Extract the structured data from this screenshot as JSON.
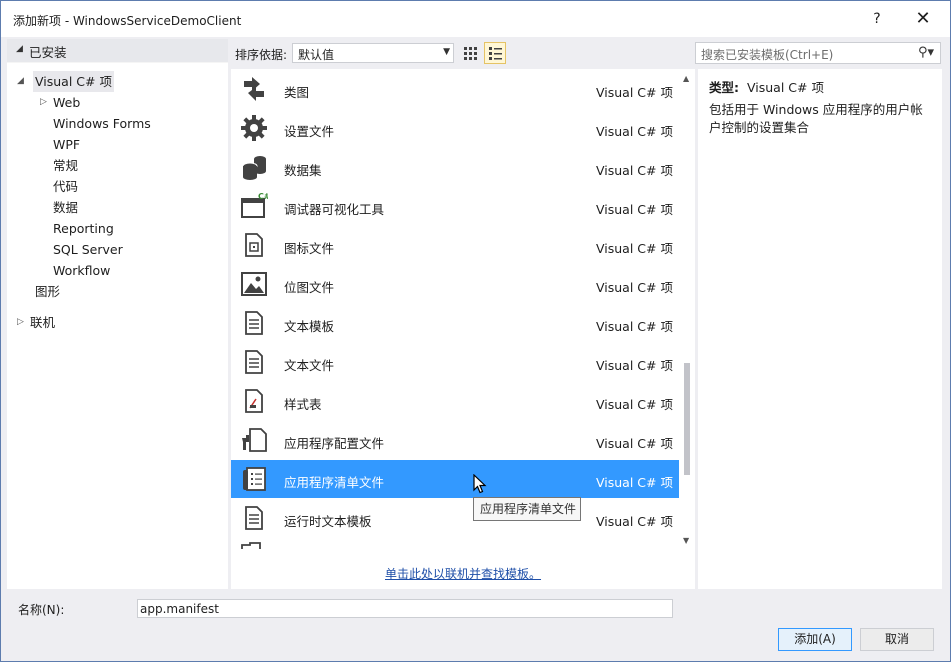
{
  "window": {
    "title": "添加新项 - WindowsServiceDemoClient",
    "help": "?",
    "close": "✕"
  },
  "tree": {
    "installed_label": "已安装",
    "items": [
      {
        "label": "Visual C# 项"
      },
      {
        "label": "Web"
      },
      {
        "label": "Windows Forms"
      },
      {
        "label": "WPF"
      },
      {
        "label": "常规"
      },
      {
        "label": "代码"
      },
      {
        "label": "数据"
      },
      {
        "label": "Reporting"
      },
      {
        "label": "SQL Server"
      },
      {
        "label": "Workflow"
      },
      {
        "label": "图形"
      },
      {
        "label": "联机"
      }
    ]
  },
  "toolbar": {
    "sort_label": "排序依据:",
    "sort_value": "默认值",
    "search_placeholder": "搜索已安装模板(Ctrl+E)"
  },
  "templates": [
    {
      "name": "类图",
      "lang": "Visual C# 项",
      "icon": "class-diagram-icon"
    },
    {
      "name": "设置文件",
      "lang": "Visual C# 项",
      "icon": "gear-icon"
    },
    {
      "name": "数据集",
      "lang": "Visual C# 项",
      "icon": "dataset-icon"
    },
    {
      "name": "调试器可视化工具",
      "lang": "Visual C# 项",
      "icon": "debugger-visualizer-icon"
    },
    {
      "name": "图标文件",
      "lang": "Visual C# 项",
      "icon": "icon-file-icon"
    },
    {
      "name": "位图文件",
      "lang": "Visual C# 项",
      "icon": "bitmap-icon"
    },
    {
      "name": "文本模板",
      "lang": "Visual C# 项",
      "icon": "text-template-icon"
    },
    {
      "name": "文本文件",
      "lang": "Visual C# 项",
      "icon": "text-file-icon"
    },
    {
      "name": "样式表",
      "lang": "Visual C# 项",
      "icon": "stylesheet-icon"
    },
    {
      "name": "应用程序配置文件",
      "lang": "Visual C# 项",
      "icon": "config-file-icon"
    },
    {
      "name": "应用程序清单文件",
      "lang": "Visual C# 项",
      "icon": "manifest-icon",
      "selected": true
    },
    {
      "name": "运行时文本模板",
      "lang": "Visual C# 项",
      "icon": "runtime-text-template-icon"
    }
  ],
  "tooltip": "应用程序清单文件",
  "online_link": "单击此处以联机并查找模板。",
  "details": {
    "type_label": "类型:",
    "type_value": "Visual C# 项",
    "description": "包括用于 Windows 应用程序的用户帐户控制的设置集合"
  },
  "footer": {
    "name_label": "名称(N):",
    "name_value": "app.manifest",
    "add_label": "添加(A)",
    "cancel_label": "取消"
  },
  "colors": {
    "selection": "#3399ff",
    "link": "#1f4fa8"
  }
}
